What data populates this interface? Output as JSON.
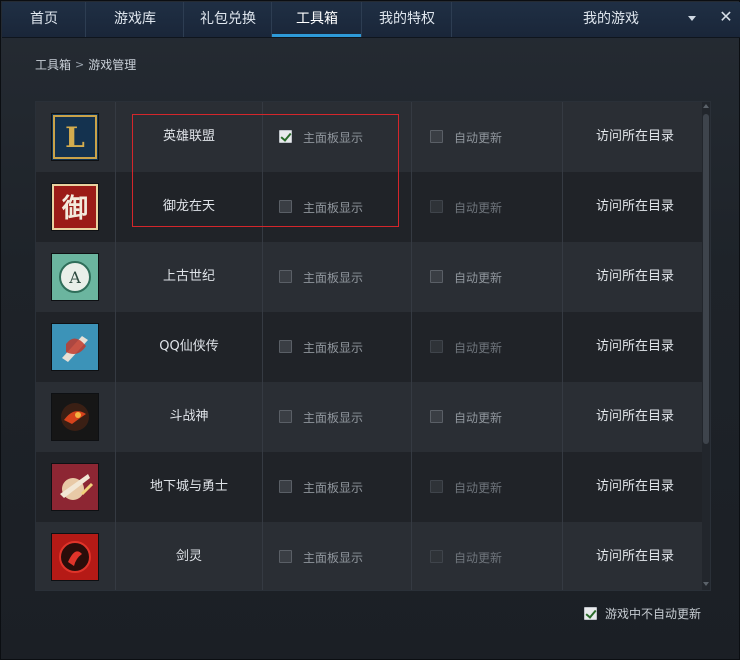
{
  "nav": {
    "items": [
      {
        "label": "首页"
      },
      {
        "label": "游戏库"
      },
      {
        "label": "礼包兑换"
      },
      {
        "label": "工具箱"
      },
      {
        "label": "我的特权"
      }
    ],
    "right_label": "我的游戏",
    "active_index": 3
  },
  "breadcrumb": {
    "parent": "工具箱",
    "current": "游戏管理"
  },
  "games": [
    {
      "name": "英雄联盟",
      "icon": "lol-icon",
      "show_on_panel": true,
      "auto_update": false
    },
    {
      "name": "御龙在天",
      "icon": "yulong-icon",
      "show_on_panel": false,
      "auto_update": false
    },
    {
      "name": "上古世纪",
      "icon": "archeage-icon",
      "show_on_panel": false,
      "auto_update": false
    },
    {
      "name": "QQ仙侠传",
      "icon": "qqxxz-icon",
      "show_on_panel": false,
      "auto_update": false
    },
    {
      "name": "斗战神",
      "icon": "douzhanshen-icon",
      "show_on_panel": false,
      "auto_update": false
    },
    {
      "name": "地下城与勇士",
      "icon": "dnf-icon",
      "show_on_panel": false,
      "auto_update": false
    },
    {
      "name": "剑灵",
      "icon": "bladesoul-icon",
      "show_on_panel": false,
      "auto_update": false
    }
  ],
  "labels": {
    "show_on_panel": "主面板显示",
    "auto_update": "自动更新",
    "visit_dir": "访问所在目录"
  },
  "footer": {
    "no_auto_update_in_game": "游戏中不自动更新",
    "checked": true
  },
  "colors": {
    "accent": "#2e9ad8",
    "highlight_box": "#d4262b"
  }
}
